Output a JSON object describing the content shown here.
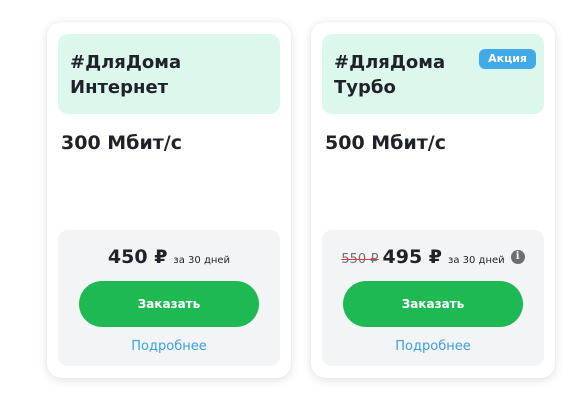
{
  "tariffs": [
    {
      "title_line1": "#ДляДома",
      "title_line2": "Интернет",
      "badge": "",
      "speed": "300 Мбит/с",
      "old_price": "",
      "price": "450 ₽",
      "period": "за 30 дней",
      "order_label": "Заказать",
      "more_label": "Подробнее"
    },
    {
      "title_line1": "#ДляДома",
      "title_line2": "Турбо",
      "badge": "Акция",
      "speed": "500 Мбит/с",
      "old_price": "550 ₽",
      "price": "495 ₽",
      "period": "за 30 дней",
      "info_icon": "info-icon",
      "order_label": "Заказать",
      "more_label": "Подробнее"
    }
  ],
  "colors": {
    "header_bg": "#dcf7ec",
    "button": "#1fb954",
    "link": "#3b9fe0",
    "badge": "#40a9e8",
    "strike": "#e43a3a"
  }
}
